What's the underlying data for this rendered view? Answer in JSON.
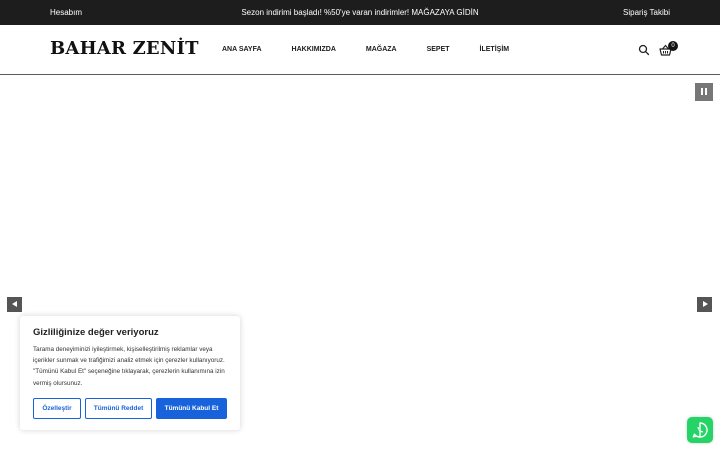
{
  "topbar": {
    "account": "Hesabım",
    "promo": "Sezon indirimi başladı! %50'ye varan indirimler! MAĞAZAYA GİDİN",
    "order_tracking": "Sipariş Takibi"
  },
  "header": {
    "logo": "BAHAR ZENİT",
    "nav": [
      "ANA SAYFA",
      "HAKKIMIZDA",
      "MAĞAZA",
      "SEPET",
      "İLETİŞİM"
    ],
    "cart_count": "0",
    "icons": {
      "search": "search-icon",
      "cart": "basket-icon"
    }
  },
  "slider": {
    "icons": {
      "pause": "pause-icon",
      "prev": "arrow-left-icon",
      "next": "arrow-right-icon"
    }
  },
  "cookie": {
    "title": "Gizliliğinize değer veriyoruz",
    "text": "Tarama deneyiminizi iyileştirmek, kişiselleştirilmiş reklamlar veya içerikler sunmak ve trafiğimizi analiz etmek için çerezler kullanıyoruz. \"Tümünü Kabul Et\" seçeneğine tıklayarak, çerezlerin kullanımına izin vermiş olursunuz.",
    "customize": "Özelleştir",
    "reject": "Tümünü Reddet",
    "accept": "Tümünü Kabul Et"
  },
  "whatsapp": {
    "icon": "whatsapp-icon"
  },
  "colors": {
    "topbar": "#1d1d1d",
    "primary": "#1863dc",
    "whatsapp": "#25d366",
    "slider_control": "#555555"
  }
}
